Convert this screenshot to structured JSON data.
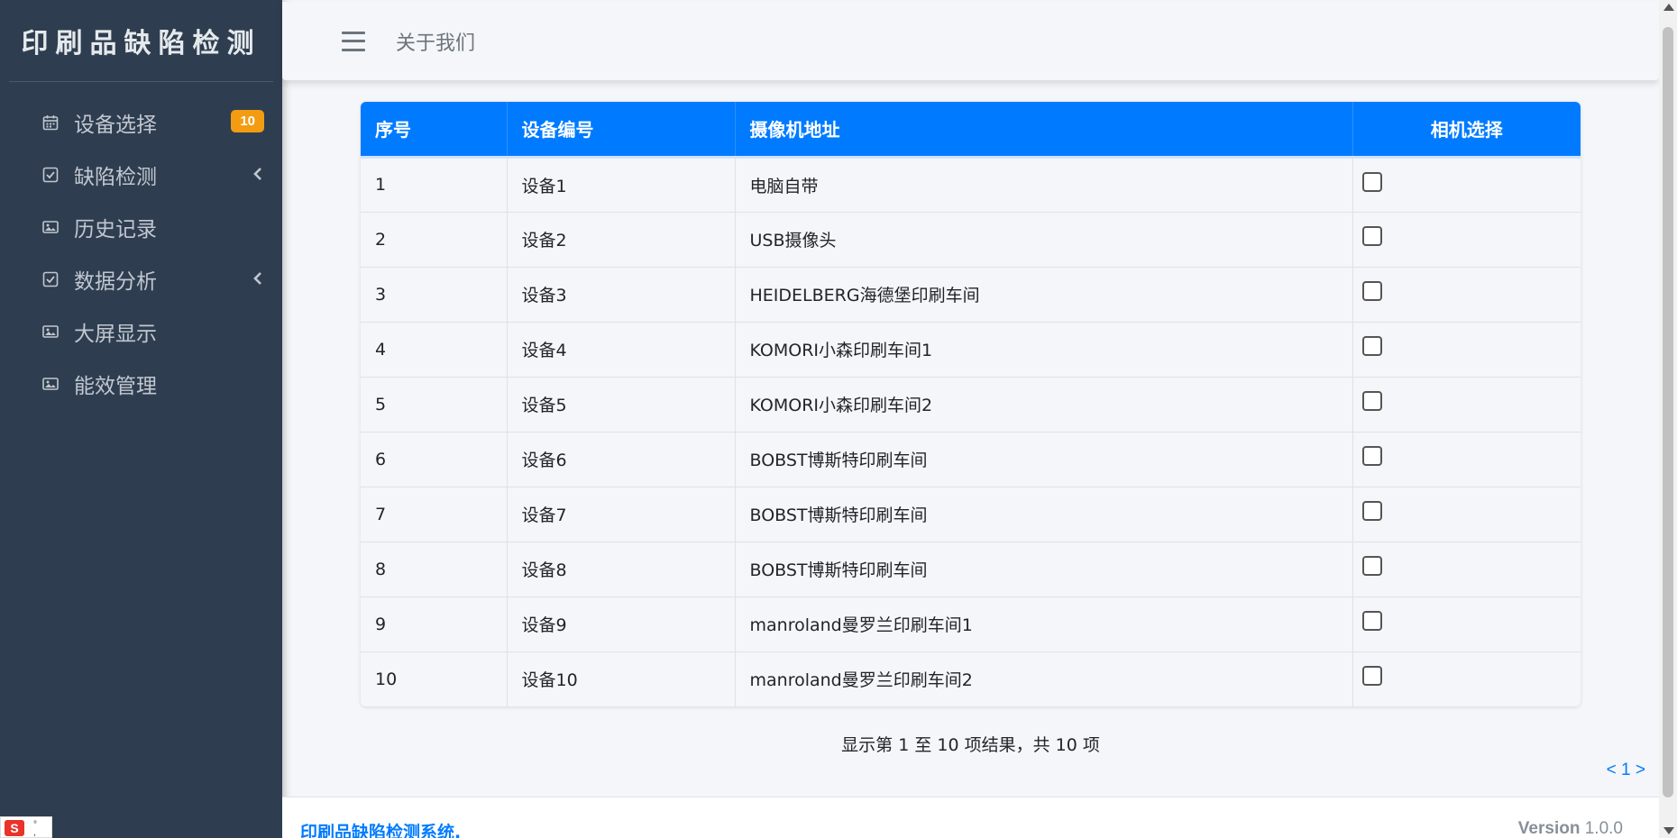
{
  "sidebar": {
    "brand": "印刷品缺陷检测",
    "items": [
      {
        "label": "设备选择",
        "icon": "calendar-icon",
        "badge": "10"
      },
      {
        "label": "缺陷检测",
        "icon": "checkbox-icon",
        "expandable": true
      },
      {
        "label": "历史记录",
        "icon": "image-icon"
      },
      {
        "label": "数据分析",
        "icon": "checkbox-icon",
        "expandable": true
      },
      {
        "label": "大屏显示",
        "icon": "image-icon"
      },
      {
        "label": "能效管理",
        "icon": "image-icon"
      }
    ]
  },
  "header": {
    "menu_icon": "hamburger-icon",
    "about_label": "关于我们"
  },
  "table": {
    "columns": [
      "序号",
      "设备编号",
      "摄像机地址",
      "相机选择"
    ],
    "rows": [
      {
        "index": "1",
        "device": "设备1",
        "camera": "电脑自带",
        "selected": false
      },
      {
        "index": "2",
        "device": "设备2",
        "camera": "USB摄像头",
        "selected": false
      },
      {
        "index": "3",
        "device": "设备3",
        "camera": "HEIDELBERG海德堡印刷车间",
        "selected": false
      },
      {
        "index": "4",
        "device": "设备4",
        "camera": "KOMORI小森印刷车间1",
        "selected": false
      },
      {
        "index": "5",
        "device": "设备5",
        "camera": "KOMORI小森印刷车间2",
        "selected": false
      },
      {
        "index": "6",
        "device": "设备6",
        "camera": "BOBST博斯特印刷车间",
        "selected": false
      },
      {
        "index": "7",
        "device": "设备7",
        "camera": "BOBST博斯特印刷车间",
        "selected": false
      },
      {
        "index": "8",
        "device": "设备8",
        "camera": "BOBST博斯特印刷车间",
        "selected": false
      },
      {
        "index": "9",
        "device": "设备9",
        "camera": "manroland曼罗兰印刷车间1",
        "selected": false
      },
      {
        "index": "10",
        "device": "设备10",
        "camera": "manroland曼罗兰印刷车间2",
        "selected": false
      }
    ],
    "summary": "显示第 1 至 10 项结果，共 10 项",
    "pager": "< 1 >"
  },
  "footer": {
    "copyright": "印刷品缺陷检测系统.",
    "version_label": "Version",
    "version_value": "1.0.0"
  },
  "colors": {
    "sidebar_bg": "#2e3e50",
    "accent": "#007bff",
    "badge": "#f39c12"
  }
}
